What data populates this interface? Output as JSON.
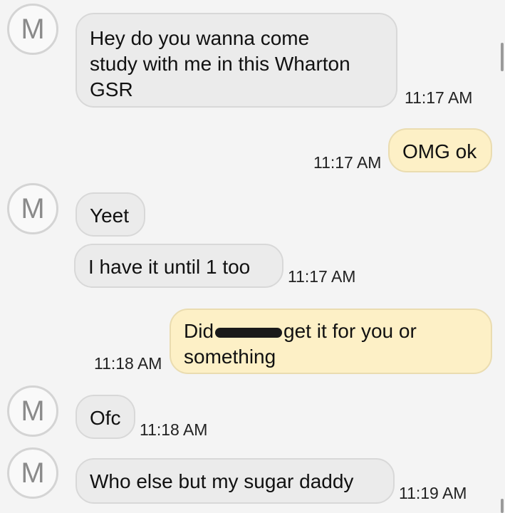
{
  "avatar_letter": "M",
  "messages": [
    {
      "lines": [
        "Hey do you wanna come",
        "study with me in this Wharton",
        "GSR"
      ],
      "time": "11:17 AM"
    },
    {
      "text": "OMG ok",
      "time": "11:17 AM"
    },
    {
      "text": "Yeet"
    },
    {
      "text": "I have it until 1 too",
      "time": "11:17 AM"
    },
    {
      "line1_before": "Did",
      "line1_after": "get it for you or",
      "line2": "something",
      "time": "11:18 AM"
    },
    {
      "text": "Ofc",
      "time": "11:18 AM"
    },
    {
      "text": "Who else but my sugar daddy",
      "time": "11:19 AM"
    }
  ]
}
